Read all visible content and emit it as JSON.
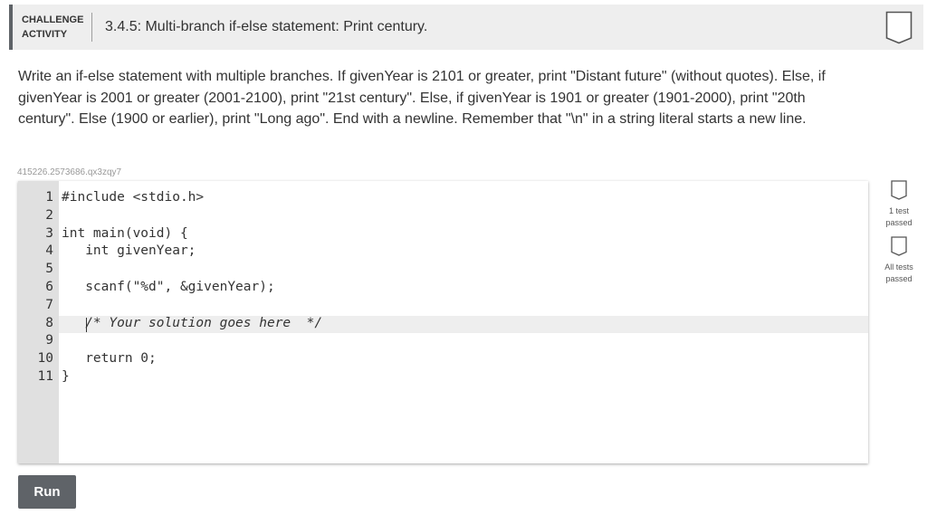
{
  "header": {
    "label_line1": "CHALLENGE",
    "label_line2": "ACTIVITY",
    "title": "3.4.5: Multi-branch if-else statement: Print century."
  },
  "instructions": "Write an if-else statement with multiple branches. If givenYear is 2101 or greater, print \"Distant future\" (without quotes). Else, if givenYear is 2001 or greater (2001-2100), print \"21st century\". Else, if givenYear is 1901 or greater (1901-2000), print \"20th century\". Else (1900 or earlier), print \"Long ago\". End with a newline. Remember that \"\\n\" in a string literal starts a new line.",
  "code_id": "415226.2573686.qx3zqy7",
  "code": {
    "lines": [
      {
        "num": "1",
        "text": "#include <stdio.h>"
      },
      {
        "num": "2",
        "text": ""
      },
      {
        "num": "3",
        "text": "int main(void) {"
      },
      {
        "num": "4",
        "text": "   int givenYear;"
      },
      {
        "num": "5",
        "text": ""
      },
      {
        "num": "6",
        "text": "   scanf(\"%d\", &givenYear);"
      },
      {
        "num": "7",
        "text": ""
      },
      {
        "num": "8",
        "text": "   /* Your solution goes here  */"
      },
      {
        "num": "9",
        "text": ""
      },
      {
        "num": "10",
        "text": "   return 0;"
      },
      {
        "num": "11",
        "text": "}"
      }
    ]
  },
  "tests": {
    "test1_line1": "1 test",
    "test1_line2": "passed",
    "test2_line1": "All tests",
    "test2_line2": "passed"
  },
  "run_label": "Run",
  "icons": {
    "header_bookmark": "bookmark-icon",
    "test_status": "test-status-icon"
  },
  "colors": {
    "header_bg": "#eeeeee",
    "accent": "#5f6368",
    "gutter_bg": "#e0e0e0",
    "run_button_bg": "#5f6368"
  }
}
